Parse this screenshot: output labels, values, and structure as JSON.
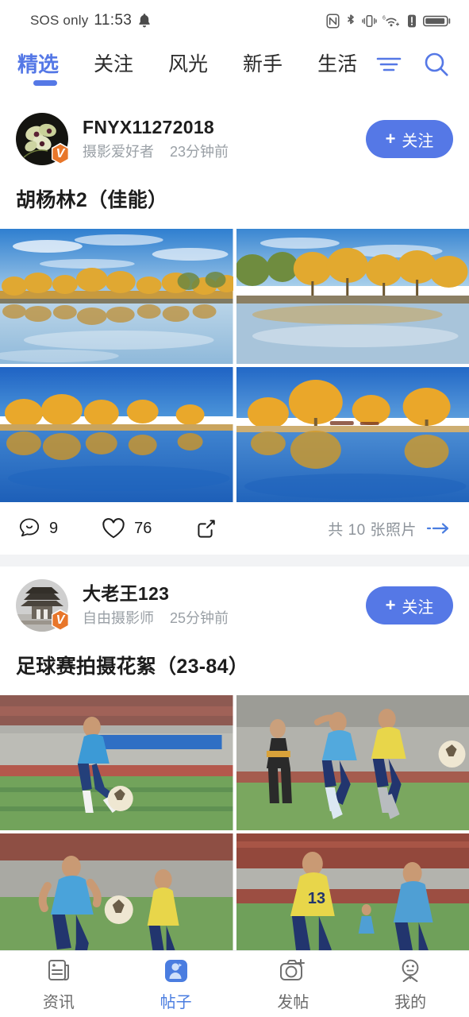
{
  "statusbar": {
    "carrier": "SOS only",
    "time": "11:53",
    "icons": [
      "bell-icon",
      "nfc-icon",
      "bluetooth-icon",
      "vibrate-icon",
      "wifi-6-icon",
      "alert-icon",
      "battery-icon"
    ]
  },
  "tabbar": {
    "tabs": [
      {
        "label": "精选",
        "active": true
      },
      {
        "label": "关注",
        "active": false
      },
      {
        "label": "风光",
        "active": false
      },
      {
        "label": "新手",
        "active": false
      },
      {
        "label": "生活",
        "active": false
      }
    ],
    "menu_icon": "menu-icon",
    "search_icon": "search-icon",
    "accent_color": "#5578e6"
  },
  "feed": {
    "posts": [
      {
        "user": {
          "name": "FNYX11272018",
          "role": "摄影爱好者",
          "time": "23分钟前",
          "badge": "V",
          "avatar_icon": "orchid-avatar"
        },
        "follow_label": "关注",
        "follow_plus": "+",
        "title": "胡杨林2（佳能）",
        "photos": [
          "poplar-lake-wide",
          "poplar-lake-trees",
          "poplar-reflection-dusk",
          "poplar-reflection-single"
        ],
        "actions": {
          "comment_count": "9",
          "like_count": "76",
          "share_icon": "share-icon"
        },
        "photo_count_text": "共 10 张照片"
      },
      {
        "user": {
          "name": "大老王123",
          "role": "自由摄影师",
          "time": "25分钟前",
          "badge": "V",
          "avatar_icon": "pagoda-avatar"
        },
        "follow_label": "关注",
        "follow_plus": "+",
        "title": "足球赛拍摄花絮（23-84）",
        "photos": [
          "soccer-player-kick",
          "soccer-duel",
          "soccer-dribble",
          "soccer-yellow-jersey"
        ]
      }
    ]
  },
  "bottomnav": {
    "items": [
      {
        "label": "资讯",
        "icon": "news-icon",
        "active": false
      },
      {
        "label": "帖子",
        "icon": "posts-icon",
        "active": true
      },
      {
        "label": "发帖",
        "icon": "camera-plus-icon",
        "active": false
      },
      {
        "label": "我的",
        "icon": "profile-icon",
        "active": false
      }
    ],
    "active_color": "#4a7de0"
  }
}
